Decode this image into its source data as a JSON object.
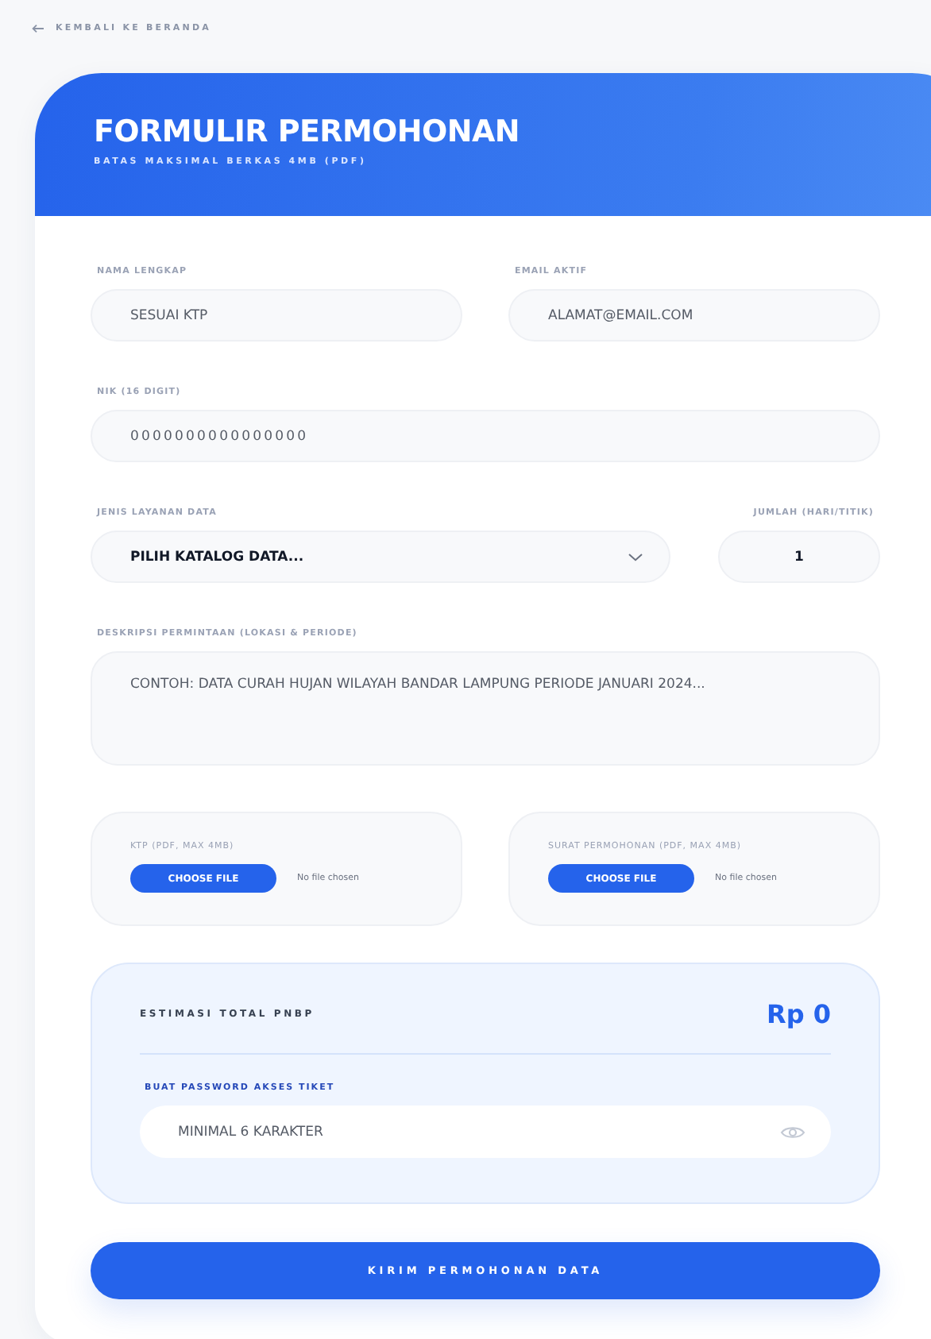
{
  "back_link": {
    "label": "KEMBALI KE BERANDA"
  },
  "header": {
    "title": "FORMULIR PERMOHONAN",
    "subtitle": "BATAS MAKSIMAL BERKAS 4MB (PDF)"
  },
  "name": {
    "label": "NAMA LENGKAP",
    "placeholder": "SESUAI KTP"
  },
  "email": {
    "label": "EMAIL AKTIF",
    "placeholder": "ALAMAT@EMAIL.COM"
  },
  "nik": {
    "label": "NIK (16 DIGIT)",
    "placeholder": "0000000000000000"
  },
  "service": {
    "label": "JENIS LAYANAN DATA",
    "value": "PILIH KATALOG DATA..."
  },
  "quantity": {
    "label": "JUMLAH (HARI/TITIK)",
    "value": "1"
  },
  "description": {
    "label": "DESKRIPSI PERMINTAAN (LOKASI & PERIODE)",
    "placeholder": "CONTOH: DATA CURAH HUJAN WILAYAH BANDAR LAMPUNG PERIODE JANUARI 2024..."
  },
  "uploads": [
    {
      "label": "KTP (PDF, MAX 4MB)",
      "button": "CHOOSE FILE",
      "status": "No file chosen"
    },
    {
      "label": "SURAT PERMOHONAN (PDF, MAX 4MB)",
      "button": "CHOOSE FILE",
      "status": "No file chosen"
    }
  ],
  "summary": {
    "label": "ESTIMASI TOTAL PNBP",
    "total": "Rp 0",
    "password": {
      "label": "BUAT PASSWORD AKSES TIKET",
      "placeholder": "MINIMAL 6 KARAKTER"
    }
  },
  "submit": {
    "label": "KIRIM PERMOHONAN DATA"
  }
}
